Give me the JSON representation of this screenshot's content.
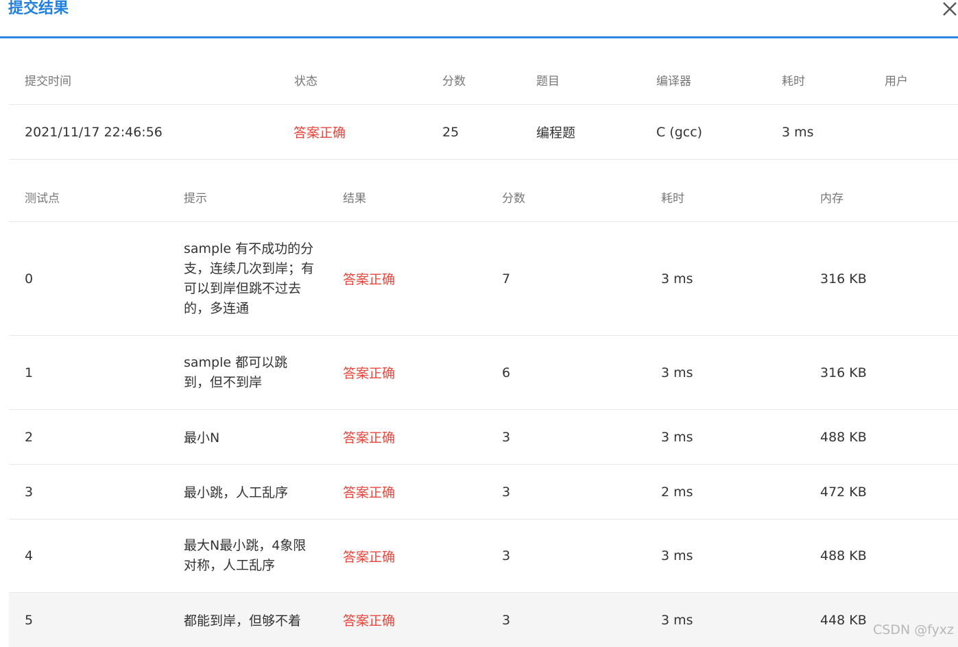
{
  "dialog": {
    "title": "提交结果",
    "close_icon": "close-icon"
  },
  "summary": {
    "headers": [
      "提交时间",
      "状态",
      "分数",
      "题目",
      "编译器",
      "耗时",
      "用户"
    ],
    "row": {
      "time": "2021/11/17 22:46:56",
      "status": "答案正确",
      "score": "25",
      "problem": "编程题",
      "compiler": "C (gcc)",
      "duration": "3 ms",
      "user": ""
    }
  },
  "tests": {
    "headers": [
      "测试点",
      "提示",
      "结果",
      "分数",
      "耗时",
      "内存"
    ],
    "rows": [
      {
        "id": "0",
        "hint": "sample 有不成功的分支，连续几次到岸；有可以到岸但跳不过去的，多连通",
        "result": "答案正确",
        "score": "7",
        "time": "3 ms",
        "memory": "316 KB"
      },
      {
        "id": "1",
        "hint": "sample 都可以跳到，但不到岸",
        "result": "答案正确",
        "score": "6",
        "time": "3 ms",
        "memory": "316 KB"
      },
      {
        "id": "2",
        "hint": "最小N",
        "result": "答案正确",
        "score": "3",
        "time": "3 ms",
        "memory": "488 KB"
      },
      {
        "id": "3",
        "hint": "最小跳，人工乱序",
        "result": "答案正确",
        "score": "3",
        "time": "2 ms",
        "memory": "472 KB"
      },
      {
        "id": "4",
        "hint": "最大N最小跳，4象限对称，人工乱序",
        "result": "答案正确",
        "score": "3",
        "time": "3 ms",
        "memory": "488 KB"
      },
      {
        "id": "5",
        "hint": "都能到岸，但够不着",
        "result": "答案正确",
        "score": "3",
        "time": "3 ms",
        "memory": "448 KB"
      }
    ]
  },
  "watermark": "CSDN @fyxz",
  "colors": {
    "accent": "#2c86e5",
    "status_ok": "#e8463c"
  }
}
